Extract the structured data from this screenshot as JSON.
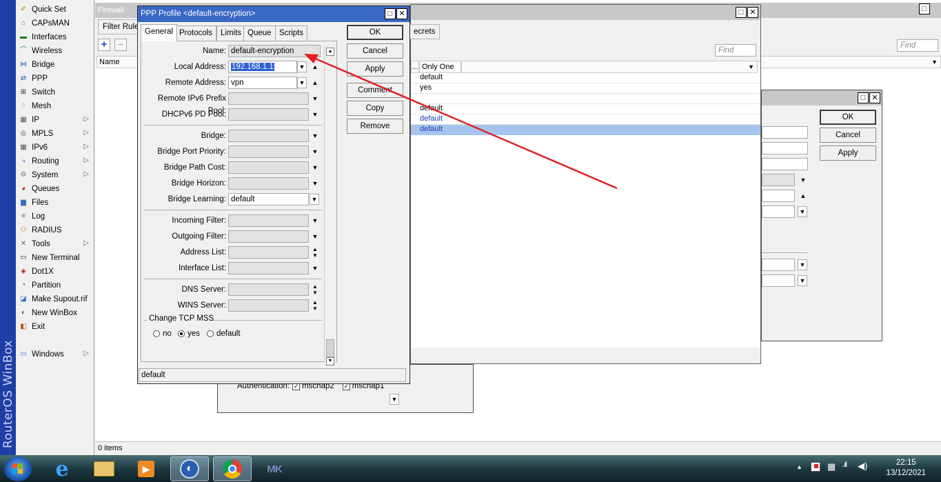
{
  "brand": "RouterOS WinBox",
  "sidebar": {
    "items": [
      {
        "label": "Quick Set",
        "icon": "wand-icon",
        "arrow": false
      },
      {
        "label": "CAPsMAN",
        "icon": "antenna-icon",
        "arrow": false
      },
      {
        "label": "Interfaces",
        "icon": "interfaces-icon",
        "arrow": false
      },
      {
        "label": "Wireless",
        "icon": "wireless-icon",
        "arrow": false
      },
      {
        "label": "Bridge",
        "icon": "bridge-icon",
        "arrow": false
      },
      {
        "label": "PPP",
        "icon": "ppp-icon",
        "arrow": false
      },
      {
        "label": "Switch",
        "icon": "switch-icon",
        "arrow": false
      },
      {
        "label": "Mesh",
        "icon": "mesh-icon",
        "arrow": false
      },
      {
        "label": "IP",
        "icon": "ip-icon",
        "arrow": true
      },
      {
        "label": "MPLS",
        "icon": "mpls-icon",
        "arrow": true
      },
      {
        "label": "IPv6",
        "icon": "ipv6-icon",
        "arrow": true
      },
      {
        "label": "Routing",
        "icon": "routing-icon",
        "arrow": true
      },
      {
        "label": "System",
        "icon": "gear-icon",
        "arrow": true
      },
      {
        "label": "Queues",
        "icon": "queues-icon",
        "arrow": false
      },
      {
        "label": "Files",
        "icon": "folder-icon",
        "arrow": false
      },
      {
        "label": "Log",
        "icon": "log-icon",
        "arrow": false
      },
      {
        "label": "RADIUS",
        "icon": "radius-icon",
        "arrow": false
      },
      {
        "label": "Tools",
        "icon": "tools-icon",
        "arrow": true
      },
      {
        "label": "New Terminal",
        "icon": "terminal-icon",
        "arrow": false
      },
      {
        "label": "Dot1X",
        "icon": "dot1x-icon",
        "arrow": false
      },
      {
        "label": "Partition",
        "icon": "partition-icon",
        "arrow": false
      },
      {
        "label": "Make Supout.rif",
        "icon": "supout-icon",
        "arrow": false
      },
      {
        "label": "New WinBox",
        "icon": "winbox-icon",
        "arrow": false
      },
      {
        "label": "Exit",
        "icon": "exit-icon",
        "arrow": false
      },
      {
        "label": "Windows",
        "icon": "windows-icon",
        "arrow": true
      }
    ]
  },
  "firewall": {
    "title": "Firewall",
    "tab_filter_rules": "Filter Rules",
    "find_placeholder": "Find",
    "col_name": "Name",
    "status": "0 items"
  },
  "ppp": {
    "tab_secrets": "ecrets",
    "find_placeholder": "Find",
    "col_only_one": "Only One",
    "col_truncated": "...",
    "rows": [
      "default",
      "yes",
      "",
      "default",
      "default",
      "default"
    ]
  },
  "sub_dialog": {
    "ok": "OK",
    "cancel": "Cancel",
    "apply": "Apply"
  },
  "bottom_dialog": {
    "auth_label": "Authentication:",
    "mschap2": "mschap2",
    "mschap1": "mschap1"
  },
  "dialog": {
    "title": "PPP Profile <default-encryption>",
    "tabs": [
      "General",
      "Protocols",
      "Limits",
      "Queue",
      "Scripts"
    ],
    "fields": {
      "name": {
        "label": "Name:",
        "value": "default-encryption"
      },
      "local_address": {
        "label": "Local Address:",
        "value": "192.168.1.1"
      },
      "remote_address": {
        "label": "Remote Address:",
        "value": "vpn"
      },
      "remote_ipv6_prefix_pool": {
        "label": "Remote IPv6 Prefix Pool:",
        "value": ""
      },
      "dhcpv6_pd_pool": {
        "label": "DHCPv6 PD Pool:",
        "value": ""
      },
      "bridge": {
        "label": "Bridge:",
        "value": ""
      },
      "bridge_port_priority": {
        "label": "Bridge Port Priority:",
        "value": ""
      },
      "bridge_path_cost": {
        "label": "Bridge Path Cost:",
        "value": ""
      },
      "bridge_horizon": {
        "label": "Bridge Horizon:",
        "value": ""
      },
      "bridge_learning": {
        "label": "Bridge Learning:",
        "value": "default"
      },
      "incoming_filter": {
        "label": "Incoming Filter:",
        "value": ""
      },
      "outgoing_filter": {
        "label": "Outgoing Filter:",
        "value": ""
      },
      "address_list": {
        "label": "Address List:",
        "value": ""
      },
      "interface_list": {
        "label": "Interface List:",
        "value": ""
      },
      "dns_server": {
        "label": "DNS Server:",
        "value": ""
      },
      "wins_server": {
        "label": "WINS Server:",
        "value": ""
      }
    },
    "tcp_mss": {
      "legend": "Change TCP MSS",
      "options": [
        "no",
        "yes",
        "default"
      ],
      "selected": "yes"
    },
    "buttons": {
      "ok": "OK",
      "cancel": "Cancel",
      "apply": "Apply",
      "comment": "Comment",
      "copy": "Copy",
      "remove": "Remove"
    },
    "status": "default"
  },
  "taskbar": {
    "time": "22:15",
    "date": "13/12/2021"
  },
  "colors": {
    "dialog_title": "#3b67c5",
    "annotation_arrow": "#e02020",
    "selection_row": "#a7c4ef"
  }
}
